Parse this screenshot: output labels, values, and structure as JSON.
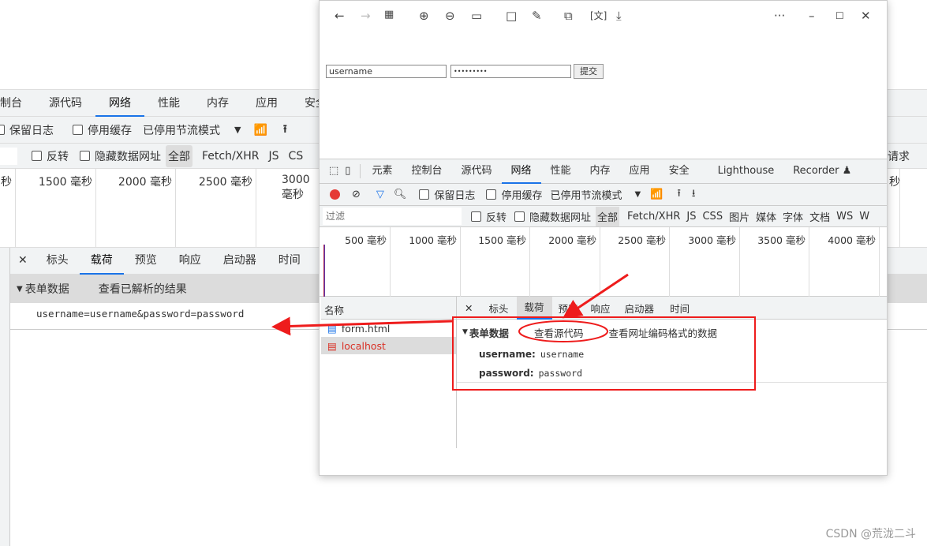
{
  "background_devtools": {
    "tabs": [
      "制台",
      "源代码",
      "网络",
      "性能",
      "内存",
      "应用",
      "安全"
    ],
    "active_tab": "网络",
    "toolbar": {
      "preserve_log": "保留日志",
      "disable_cache": "停用缓存",
      "throttling": "已停用节流模式"
    },
    "filter": {
      "invert": "反转",
      "hide_data_urls": "隐藏数据网址",
      "all": "全部",
      "types": [
        "Fetch/XHR",
        "JS",
        "CS"
      ],
      "right_text": "请求"
    },
    "timeline_ticks": [
      "秒",
      "1500 毫秒",
      "2000 毫秒",
      "2500 毫秒",
      "3000 毫秒",
      "秒"
    ],
    "detail_tabs": [
      "标头",
      "载荷",
      "预览",
      "响应",
      "启动器",
      "时间"
    ],
    "active_detail_tab": "载荷",
    "form_data_label": "表单数据",
    "view_parsed": "查看已解析的结果",
    "payload_source": "username=username&password=password"
  },
  "browser_window": {
    "toolbar_icons": [
      "back-icon",
      "forward-icon",
      "apps-icon",
      "zoom-in-icon",
      "zoom-out-icon",
      "fit-icon",
      "rotate-icon",
      "edit-icon",
      "copy-icon",
      "translate-icon",
      "download-icon",
      "more-icon",
      "minimize-icon",
      "maximize-icon",
      "close-icon"
    ],
    "form": {
      "username_value": "username",
      "password_value": "•••••••••",
      "submit_label": "提交"
    },
    "devtools": {
      "tabs": [
        "元素",
        "控制台",
        "源代码",
        "网络",
        "性能",
        "内存",
        "应用",
        "安全",
        "Lighthouse",
        "Recorder ♟"
      ],
      "active_tab": "网络",
      "toolbar": {
        "preserve_log": "保留日志",
        "disable_cache": "停用缓存",
        "throttling": "已停用节流模式"
      },
      "filter": {
        "placeholder": "过滤",
        "invert": "反转",
        "hide_data_urls": "隐藏数据网址",
        "all": "全部",
        "types": [
          "Fetch/XHR",
          "JS",
          "CSS",
          "图片",
          "媒体",
          "字体",
          "文档",
          "WS",
          "W"
        ]
      },
      "timeline_ticks": [
        "500 毫秒",
        "1000 毫秒",
        "1500 毫秒",
        "2000 毫秒",
        "2500 毫秒",
        "3000 毫秒",
        "3500 毫秒",
        "4000 毫秒"
      ],
      "list_header": "名称",
      "requests": [
        {
          "name": "form.html"
        },
        {
          "name": "localhost",
          "selected": true,
          "color": "#d93025"
        }
      ],
      "detail_tabs": [
        "标头",
        "载荷",
        "预览",
        "响应",
        "启动器",
        "时间"
      ],
      "active_detail_tab": "载荷",
      "form_data_label": "表单数据",
      "view_source": "查看源代码",
      "view_url_encoded": "查看网址编码格式的数据",
      "fields": [
        {
          "key": "username:",
          "value": "username"
        },
        {
          "key": "password:",
          "value": "password"
        }
      ]
    }
  },
  "annotation_color": "#ee1c1c",
  "watermark": "CSDN @荒泷二斗"
}
